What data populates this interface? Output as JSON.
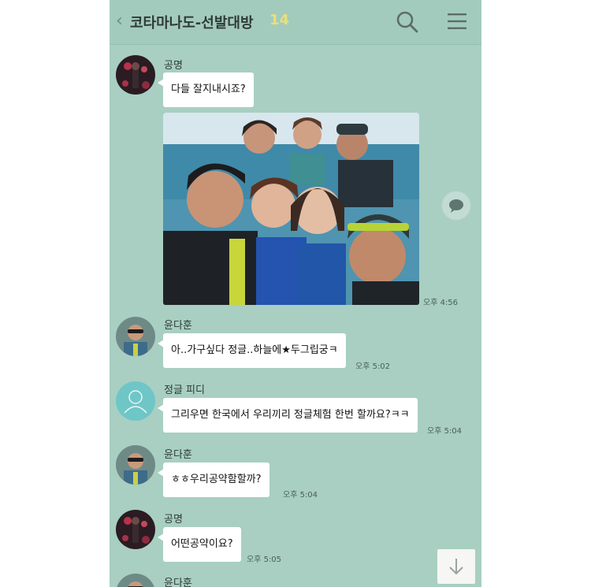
{
  "header": {
    "back_symbol": "‹",
    "title": "코타마나도-선발대방",
    "member_count": "14"
  },
  "messages": [
    {
      "sender": "공명",
      "text": "다들 잘지내시죠?",
      "time": ""
    },
    {
      "sender": "",
      "text": "",
      "time": "오후 4:56",
      "type": "photo"
    },
    {
      "sender": "윤다훈",
      "text": "아..가구싶다 정글..하늘에★두그립궁ㅋ",
      "time": "오후 5:02"
    },
    {
      "sender": "정글 피디",
      "text": "그리우면 한국에서 우리끼리 정글체험 한번 할까요?ㅋㅋ",
      "time": "오후 5:04"
    },
    {
      "sender": "윤다훈",
      "text": "ㅎㅎ우리공약함할까?",
      "time": "오후 5:04"
    },
    {
      "sender": "공명",
      "text": "어떤공약이요?",
      "time": "오후 5:05"
    },
    {
      "sender": "윤다훈",
      "text": "",
      "time": ""
    }
  ],
  "icons": {
    "search": "search-icon",
    "menu": "menu-icon",
    "share": "speech-bubble-icon",
    "scroll": "arrow-down-icon"
  },
  "colors": {
    "chat_background": "#a8cfc2",
    "bubble": "#ffffff",
    "member_count": "#e8e07a"
  }
}
